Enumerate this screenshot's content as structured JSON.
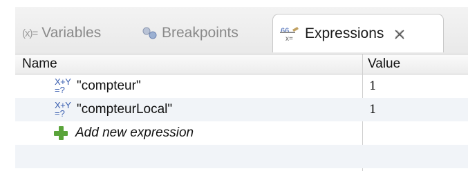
{
  "tabs": [
    {
      "label": "Variables",
      "icon": "variables-icon"
    },
    {
      "label": "Breakpoints",
      "icon": "breakpoints-icon"
    },
    {
      "label": "Expressions",
      "icon": "expressions-icon",
      "active": true
    }
  ],
  "variables_icon_text": "(x)=",
  "table": {
    "columns": [
      "Name",
      "Value"
    ],
    "rows": [
      {
        "name": "\"compteur\"",
        "value": "1",
        "icon_top": "X+Y",
        "icon_bottom": "=?"
      },
      {
        "name": "\"compteurLocal\"",
        "value": "1",
        "icon_top": "X+Y",
        "icon_bottom": "=?"
      }
    ],
    "add_label": "Add new expression"
  },
  "colors": {
    "accent_green": "#5aa43a",
    "icon_blue": "#3a5fb0"
  }
}
